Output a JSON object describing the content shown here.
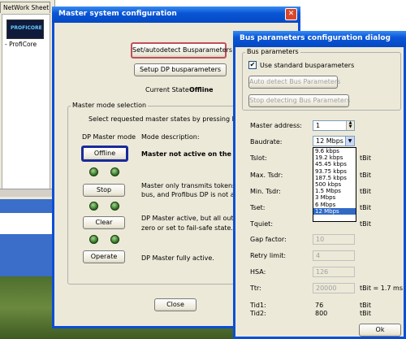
{
  "background": {
    "sheet_tab": "NetWork Sheet",
    "device_label": "- ProfiCore",
    "device_logo_text": "PROFICORE"
  },
  "master_dialog": {
    "title": "Master system configuration",
    "close_icon": "close-icon",
    "set_autodetect_label": "Set/autodetect Busparameters",
    "setup_dp_label": "Setup DP busparameters",
    "current_state_label": "Current State :",
    "current_state_value": "Offline",
    "group_label": "Master mode selection",
    "instruction": "Select requested master states by pressing buttons be",
    "col_mode": "DP Master mode",
    "col_desc": "Mode description:",
    "modes": [
      {
        "button": "Offline",
        "desc1": "Master not active on the bus.",
        "desc2": ""
      },
      {
        "button": "Stop",
        "desc1": "Master only transmits tokens on the",
        "desc2": "bus, and Profibus DP is not active."
      },
      {
        "button": "Clear",
        "desc1": "DP Master active, but all outputs are",
        "desc2": "zero or set to fail-safe state."
      },
      {
        "button": "Operate",
        "desc1": "DP Master fully active.",
        "desc2": ""
      }
    ],
    "close_label": "Close"
  },
  "bus_dialog": {
    "title": "Bus parameters configuration dialog",
    "group_label": "Bus parameters",
    "use_standard_label": "Use standard busparameters",
    "use_standard_checked": true,
    "auto_detect_label": "Auto detect Bus Parameters",
    "stop_detect_label": "Stop detecting Bus Parameters",
    "master_address_label": "Master address:",
    "master_address_value": "1",
    "baudrate_label": "Baudrate:",
    "baudrate_value": "12 Mbps",
    "baud_options": [
      "9.6 kbps",
      "19.2 kbps",
      "45.45 kbps",
      "93.75 kbps",
      "187.5 kbps",
      "500 kbps",
      "1.5 Mbps",
      "3 Mbps",
      "6 Mbps",
      "12 Mbps"
    ],
    "tslot_label": "Tslot:",
    "max_tsdr_label": "Max. Tsdr:",
    "min_tsdr_label": "Min. Tsdr:",
    "tset_label": "Tset:",
    "tquiet_label": "Tquiet:",
    "gap_label": "Gap factor:",
    "gap_value": "10",
    "retry_label": "Retry limit:",
    "retry_value": "4",
    "hsa_label": "HSA:",
    "hsa_value": "126",
    "ttr_label": "Ttr:",
    "ttr_value": "20000",
    "ttr_unit": "tBit = 1.7 ms",
    "unit": "tBit",
    "tid1_label": "Tid1:",
    "tid1_value": "76",
    "tid2_label": "Tid2:",
    "tid2_value": "800",
    "ok_label": "Ok"
  }
}
